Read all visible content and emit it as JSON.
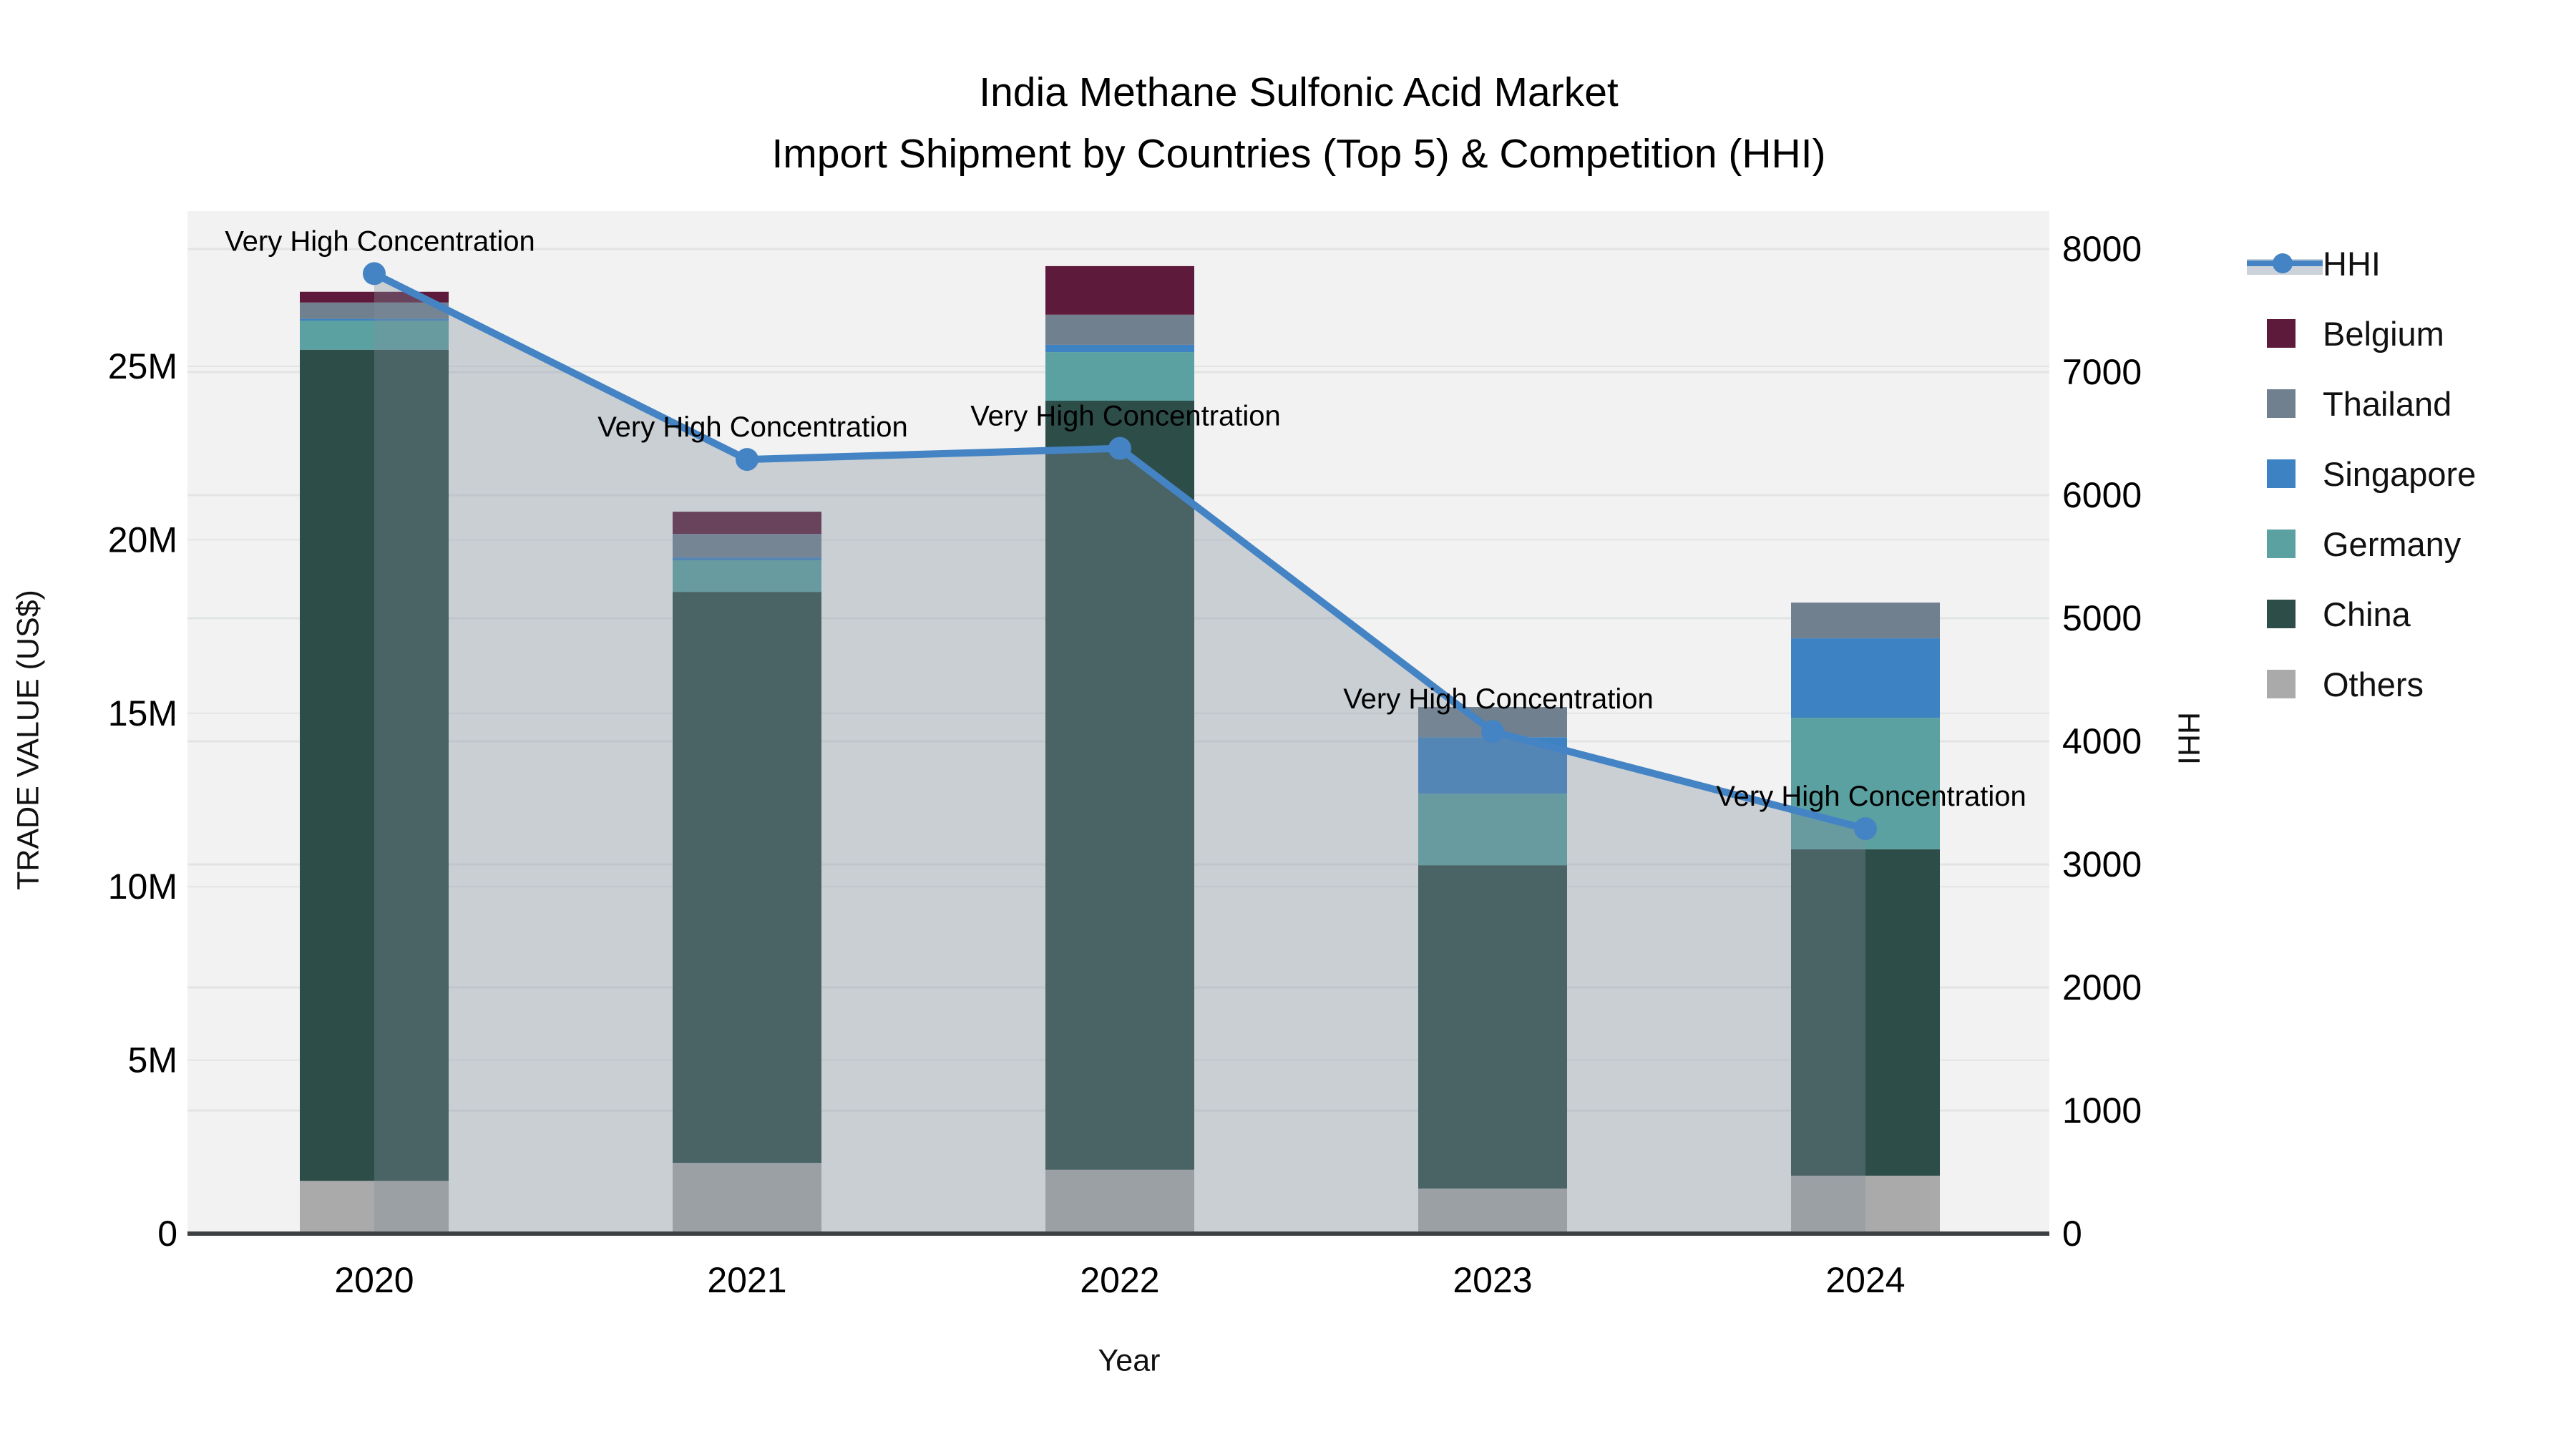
{
  "title": {
    "line1": "India Methane Sulfonic Acid Market",
    "line2": "Import Shipment by Countries (Top 5) & Competition (HHI)"
  },
  "axes": {
    "x_label": "Year",
    "left_label": "TRADE VALUE (US$)",
    "right_label": "HHI",
    "left_ticks": [
      "0",
      "5M",
      "10M",
      "15M",
      "20M",
      "25M"
    ],
    "right_ticks": [
      "0",
      "1000",
      "2000",
      "3000",
      "4000",
      "5000",
      "6000",
      "7000",
      "8000"
    ]
  },
  "legend": {
    "items": [
      {
        "label": "HHI"
      },
      {
        "label": "Belgium"
      },
      {
        "label": "Thailand"
      },
      {
        "label": "Singapore"
      },
      {
        "label": "Germany"
      },
      {
        "label": "China"
      },
      {
        "label": "Others"
      }
    ]
  },
  "colors": {
    "HHI": "#4484c4",
    "Belgium": "#5d1a3a",
    "Thailand": "#70808f",
    "Singapore": "#3d82c2",
    "Germany": "#5ba1a2",
    "China": "#2d4d49",
    "Others": "#aaaaaa",
    "area_fill": "rgba(130,142,158,0.35)",
    "legend_band": "#ccd2da",
    "plot_bg": "#f2f2f2",
    "grid": "#e2e4e4",
    "axis_line": "#3d4040",
    "text": "#000000"
  },
  "chart_data": {
    "type": "combo: stacked-bar (left axis) + line (right axis)",
    "title": "India Methane Sulfonic Acid Market — Import Shipment by Countries (Top 5) & Competition (HHI)",
    "categories": [
      "2020",
      "2021",
      "2022",
      "2023",
      "2024"
    ],
    "bar_value_unit": "million US$",
    "series": [
      {
        "name": "Others",
        "values": [
          1.52,
          2.04,
          1.84,
          1.3,
          1.67
        ]
      },
      {
        "name": "China",
        "values": [
          23.96,
          16.46,
          22.17,
          9.32,
          9.41
        ]
      },
      {
        "name": "Germany",
        "values": [
          0.84,
          0.91,
          1.4,
          2.06,
          3.79
        ]
      },
      {
        "name": "Singapore",
        "values": [
          0.05,
          0.08,
          0.21,
          1.63,
          2.29
        ]
      },
      {
        "name": "Thailand",
        "values": [
          0.47,
          0.68,
          0.87,
          0.87,
          1.03
        ]
      },
      {
        "name": "Belgium",
        "values": [
          0.31,
          0.64,
          1.4,
          0,
          0
        ]
      }
    ],
    "bar_totals_musd": [
      27.15,
      20.81,
      27.89,
      15.18,
      18.19
    ],
    "line_series": {
      "name": "HHI",
      "axis": "right",
      "values": [
        7800,
        6290,
        6380,
        4080,
        3290
      ],
      "has_area_fill": true
    },
    "annotations": [
      "Very High Concentration",
      "Very High Concentration",
      "Very High Concentration",
      "Very High Concentration",
      "Very High Concentration"
    ],
    "xlabel": "Year",
    "ylabel_left": "TRADE VALUE (US$)",
    "ylabel_right": "HHI",
    "ylim_left_musd": [
      0,
      29.5
    ],
    "ylim_right": [
      0,
      8300
    ],
    "grid": true,
    "legend_position": "right"
  }
}
